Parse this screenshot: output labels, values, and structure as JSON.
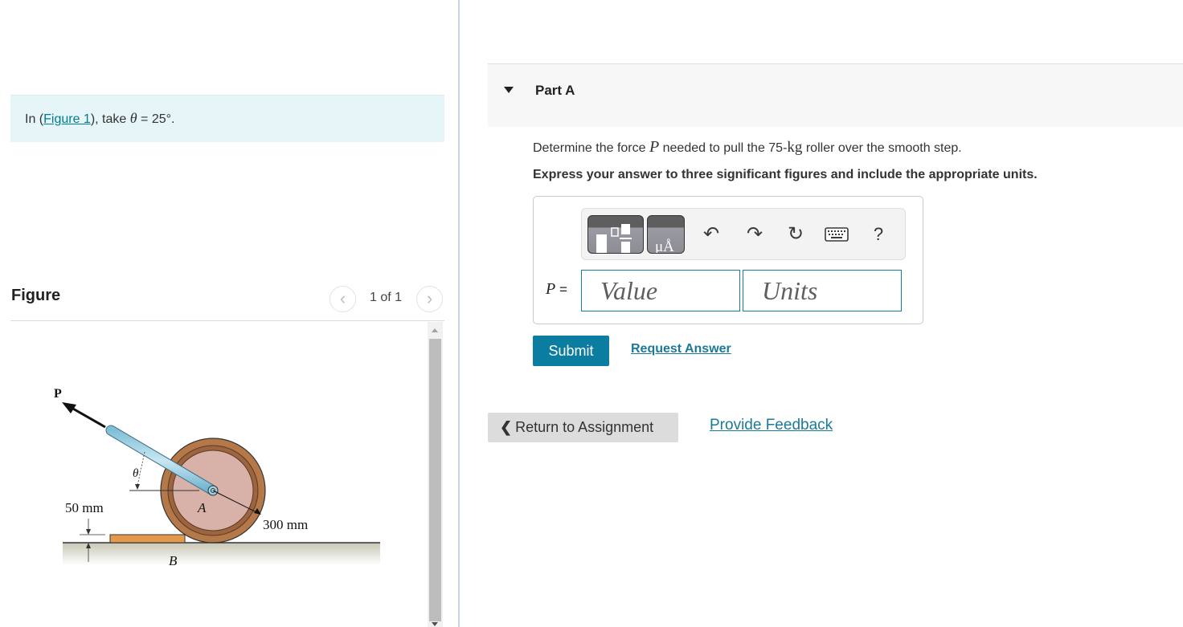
{
  "intro": {
    "prefix": "In (",
    "figure_link": "Figure 1",
    "middle": "), take ",
    "theta_symbol": "θ",
    "suffix": " = 25°."
  },
  "figure_panel": {
    "title": "Figure",
    "counter": "1 of 1",
    "prev_icon": "‹",
    "next_icon": "›",
    "labels": {
      "force": "P",
      "angle": "θ",
      "center": "A",
      "step_point": "B",
      "step_height": "50 mm",
      "radius": "300 mm"
    }
  },
  "part": {
    "title": "Part A",
    "question_pre": "Determine the force ",
    "question_var": "P",
    "question_mid": " needed to pull the 75-",
    "question_unit": "kg",
    "question_post": " roller over the smooth step.",
    "instruction": "Express your answer to three significant figures and include the appropriate units."
  },
  "toolbar": {
    "units_label": "μÅ",
    "undo_icon": "↶",
    "redo_icon": "↷",
    "reset_icon": "↻",
    "help_label": "?"
  },
  "answer": {
    "var": "P",
    "equals": " =",
    "value_placeholder": "Value",
    "units_placeholder": "Units",
    "value": "",
    "units": ""
  },
  "actions": {
    "submit": "Submit",
    "request_answer": "Request Answer",
    "return": "Return to Assignment",
    "return_icon": "❮",
    "feedback": "Provide Feedback"
  },
  "colors": {
    "accent": "#0b7da0",
    "link": "#1b7a99",
    "intro_bg": "#e6f5f7"
  }
}
